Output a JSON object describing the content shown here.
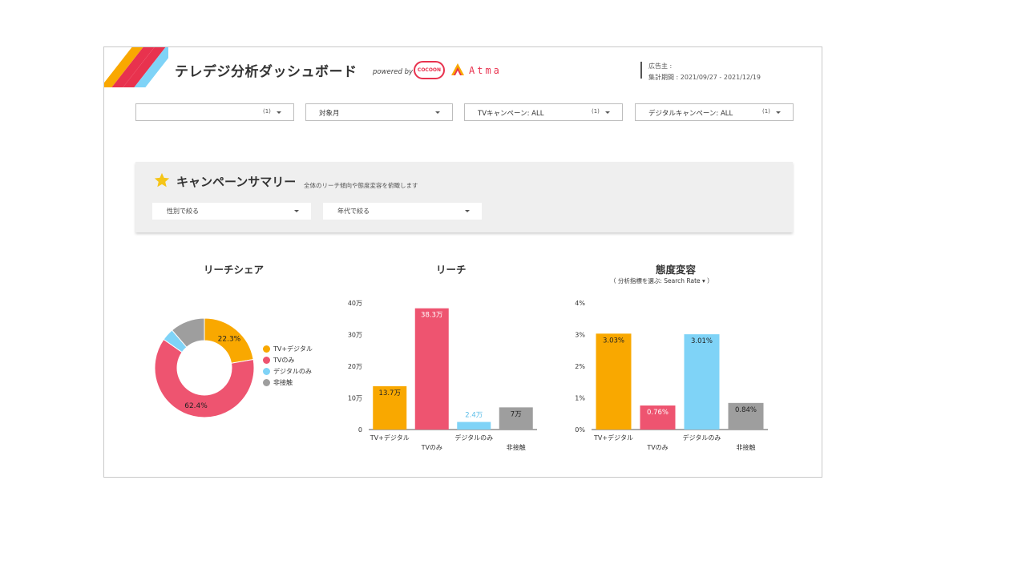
{
  "header": {
    "title": "テレデジ分析ダッシュボード",
    "powered_by": "powered by",
    "cocoon_logo_text": "COCOON",
    "atma_logo_text": "Atma",
    "advertiser_label": "広告主 :",
    "period_label": "集計期間 : 2021/09/27 - 2021/12/19"
  },
  "filters": [
    {
      "label": "",
      "count": "(1)"
    },
    {
      "label": "対象月",
      "count": ""
    },
    {
      "label": "TVキャンペーン: ALL",
      "count": "(1)"
    },
    {
      "label": "デジタルキャンペーン: ALL",
      "count": "(1)"
    }
  ],
  "summary": {
    "title": "キャンペーンサマリー",
    "subtitle": "全体のリーチ傾向や態度変容を俯瞰します",
    "gender_select": "性別で絞る",
    "age_select": "年代で絞る"
  },
  "panels": {
    "reach_share_title": "リーチシェア",
    "reach_title": "リーチ",
    "attitude_title": "態度変容",
    "metric_selector": "（  分析指標を選ぶ: Search Rate          ▾  ）"
  },
  "colors": {
    "tv_digital": "#f9a800",
    "tv_only": "#ee5470",
    "digital_only": "#7fd3f7",
    "no_contact": "#9e9e9e",
    "stripe_orange": "#f9a800",
    "stripe_red": "#e8324e",
    "stripe_blue": "#7fd3f7"
  },
  "chart_data": [
    {
      "type": "pie",
      "categories": [
        "TV+デジタル",
        "TVのみ",
        "デジタルのみ",
        "非接触"
      ],
      "values": [
        22.3,
        62.4,
        4.0,
        11.3
      ],
      "data_labels": [
        "22.3%",
        "62.4%",
        "",
        ""
      ],
      "title": "リーチシェア",
      "legend": "right"
    },
    {
      "type": "bar",
      "categories": [
        "TV+デジタル",
        "TVのみ",
        "デジタルのみ",
        "非接触"
      ],
      "values": [
        13.7,
        38.3,
        2.4,
        7
      ],
      "data_labels": [
        "13.7万",
        "38.3万",
        "2.4万",
        "7万"
      ],
      "title": "リーチ",
      "ylim": [
        0,
        40
      ],
      "yticks": [
        "0",
        "10万",
        "20万",
        "30万",
        "40万"
      ]
    },
    {
      "type": "bar",
      "categories": [
        "TV+デジタル",
        "TVのみ",
        "デジタルのみ",
        "非接触"
      ],
      "values": [
        3.03,
        0.76,
        3.01,
        0.84
      ],
      "data_labels": [
        "3.03%",
        "0.76%",
        "3.01%",
        "0.84%"
      ],
      "title": "態度変容",
      "ylim": [
        0,
        4
      ],
      "yticks": [
        "0%",
        "1%",
        "2%",
        "3%",
        "4%"
      ]
    }
  ]
}
